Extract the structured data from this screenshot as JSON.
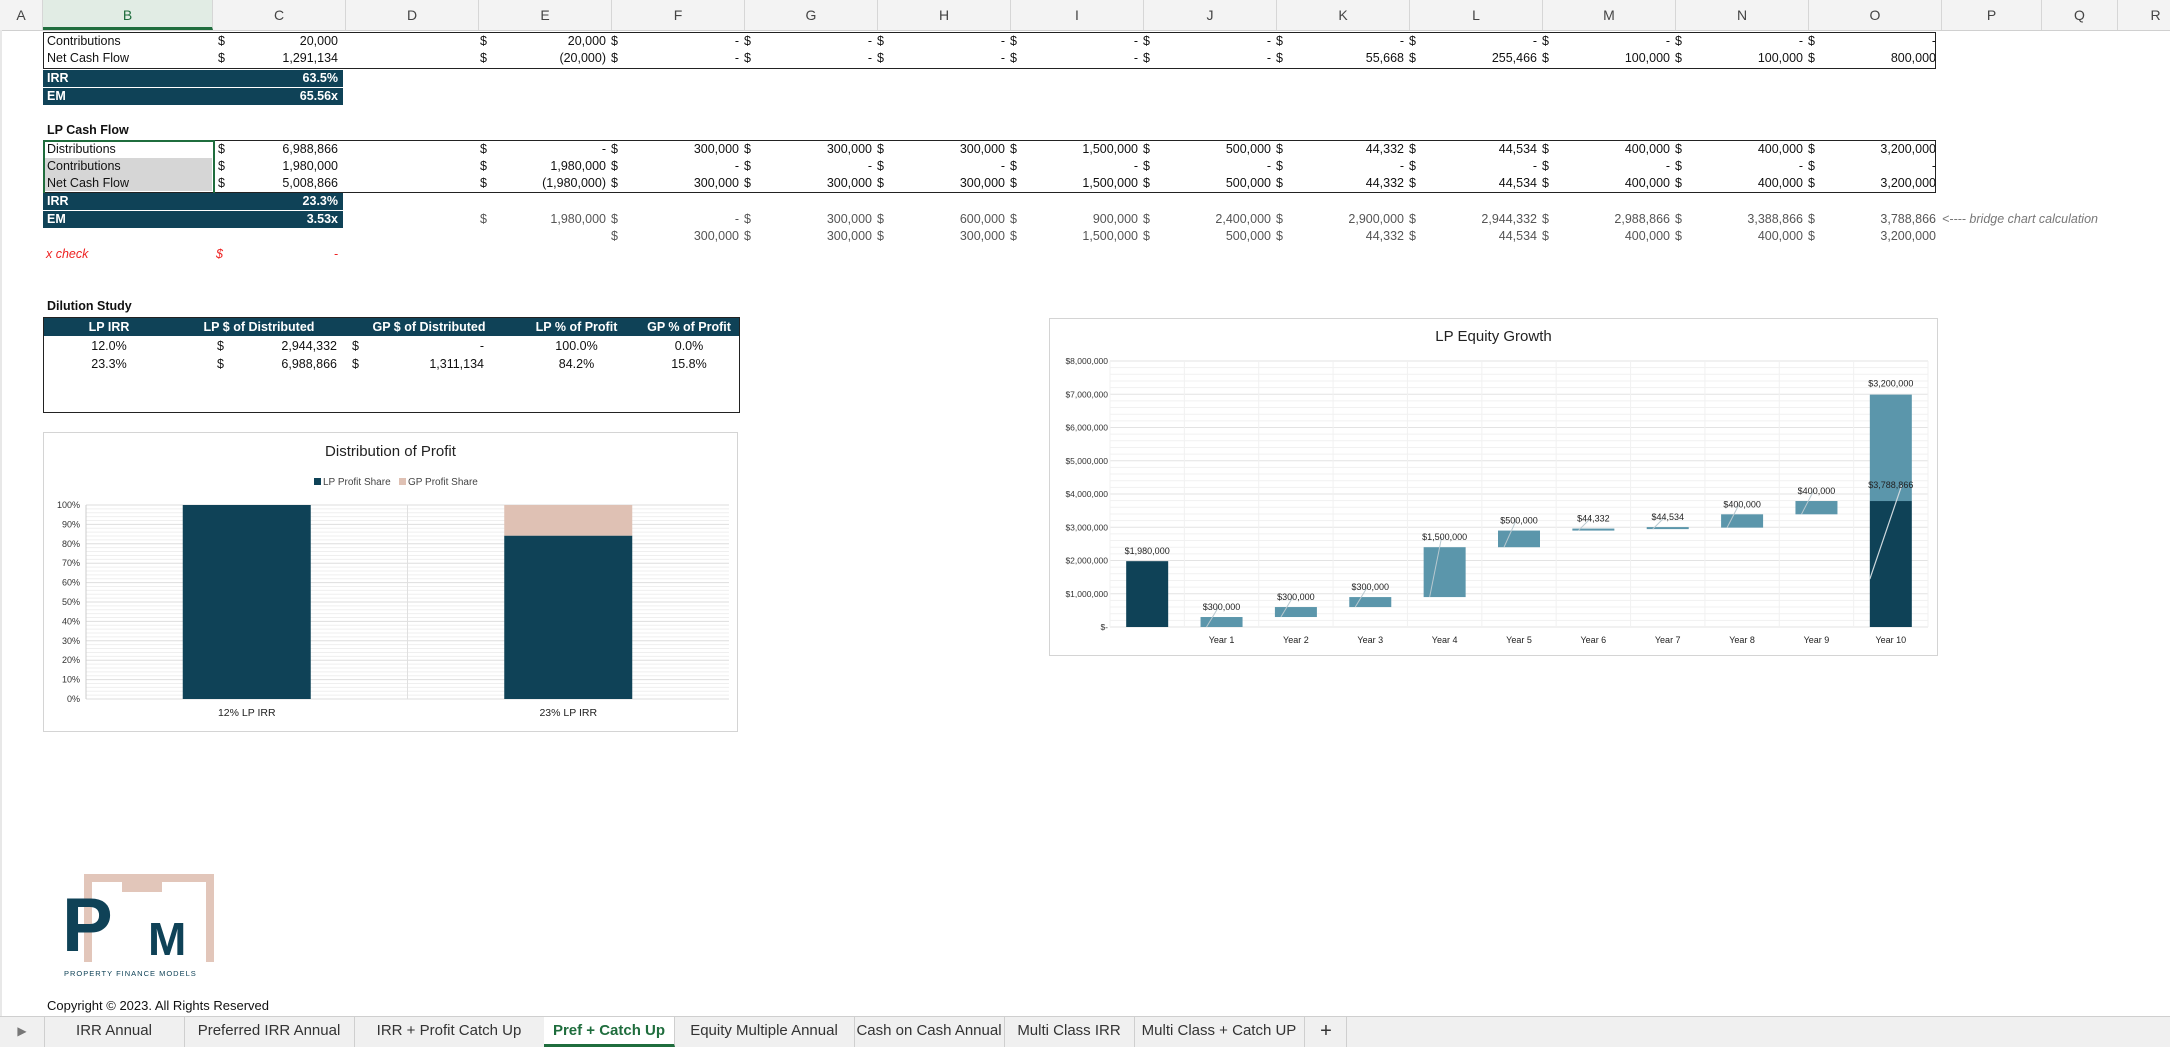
{
  "columns": [
    "A",
    "B",
    "C",
    "D",
    "E",
    "F",
    "G",
    "H",
    "I",
    "J",
    "K",
    "L",
    "M",
    "N",
    "O",
    "P",
    "Q",
    "R"
  ],
  "selected_column": "B",
  "top_table": {
    "rows": [
      {
        "label": "Contributions",
        "c": "20,000",
        "e": "20,000",
        "vals": [
          "-",
          "-",
          "-",
          "-",
          "-",
          "-",
          "-",
          "-",
          "-",
          "-"
        ]
      },
      {
        "label": "Net Cash Flow",
        "c": "1,291,134",
        "e": "(20,000)",
        "vals": [
          "-",
          "-",
          "-",
          "-",
          "-",
          "55,668",
          "255,466",
          "100,000",
          "100,000",
          "800,000"
        ]
      }
    ],
    "irr_label": "IRR",
    "irr_value": "63.5%",
    "em_label": "EM",
    "em_value": "65.56x"
  },
  "lp_cash_flow": {
    "title": "LP Cash Flow",
    "rows": [
      {
        "label": "Distributions",
        "c": "6,988,866",
        "e": "-",
        "vals": [
          "300,000",
          "300,000",
          "300,000",
          "1,500,000",
          "500,000",
          "44,332",
          "44,534",
          "400,000",
          "400,000",
          "3,200,000"
        ]
      },
      {
        "label": "Contributions",
        "c": "1,980,000",
        "e": "1,980,000",
        "vals": [
          "-",
          "-",
          "-",
          "-",
          "-",
          "-",
          "-",
          "-",
          "-",
          "-"
        ]
      },
      {
        "label": "Net Cash Flow",
        "c": "5,008,866",
        "e": "(1,980,000)",
        "vals": [
          "300,000",
          "300,000",
          "300,000",
          "1,500,000",
          "500,000",
          "44,332",
          "44,534",
          "400,000",
          "400,000",
          "3,200,000"
        ]
      }
    ],
    "irr_label": "IRR",
    "irr_value": "23.3%",
    "em_label": "EM",
    "em_value": "3.53x",
    "bridge_row1": {
      "e": "1,980,000",
      "vals": [
        "-",
        "300,000",
        "600,000",
        "900,000",
        "2,400,000",
        "2,900,000",
        "2,944,332",
        "2,988,866",
        "3,388,866",
        "3,788,866"
      ]
    },
    "bridge_row2": {
      "vals": [
        "300,000",
        "300,000",
        "300,000",
        "1,500,000",
        "500,000",
        "44,332",
        "44,534",
        "400,000",
        "400,000",
        "3,200,000"
      ]
    },
    "bridge_note": "<---- bridge chart calculation",
    "check_label": "x check",
    "check_currency": "$",
    "check_value": "-"
  },
  "currency_symbol": "$",
  "dilution": {
    "title": "Dilution Study",
    "headers": [
      "LP IRR",
      "LP $ of Distributed",
      "GP $ of Distributed",
      "LP % of Profit",
      "GP % of Profit"
    ],
    "rows": [
      {
        "irr": "12.0%",
        "lp": "2,944,332",
        "gp": "-",
        "lp_pct": "100.0%",
        "gp_pct": "0.0%"
      },
      {
        "irr": "23.3%",
        "lp": "6,988,866",
        "gp": "1,311,134",
        "lp_pct": "84.2%",
        "gp_pct": "15.8%"
      }
    ]
  },
  "chart_data": [
    {
      "type": "bar",
      "title": "Distribution of Profit",
      "categories": [
        "12%  LP IRR",
        "23%  LP IRR"
      ],
      "series": [
        {
          "name": "LP Profit Share",
          "values": [
            100.0,
            84.2
          ],
          "color": "#0f4257"
        },
        {
          "name": "GP Profit Share",
          "values": [
            0.0,
            15.8
          ],
          "color": "#dfc1b4"
        }
      ],
      "stacked": true,
      "ylim": [
        0,
        100
      ],
      "yticks": [
        "0%",
        "10%",
        "20%",
        "30%",
        "40%",
        "50%",
        "60%",
        "70%",
        "80%",
        "90%",
        "100%"
      ],
      "legend": "top"
    },
    {
      "type": "bar",
      "title": "LP Equity Growth",
      "waterfall": true,
      "categories": [
        "",
        "Year 1",
        "Year 2",
        "Year 3",
        "Year 4",
        "Year 5",
        "Year 6",
        "Year 7",
        "Year 8",
        "Year 9",
        "Year 10"
      ],
      "base": [
        0,
        0,
        300000,
        600000,
        900000,
        2400000,
        2900000,
        2944332,
        2988866,
        3388866,
        3788866
      ],
      "values": [
        1980000,
        300000,
        300000,
        300000,
        1500000,
        500000,
        44332,
        44534,
        400000,
        400000,
        3200000
      ],
      "labels": [
        "$1,980,000",
        "$300,000",
        "$300,000",
        "$300,000",
        "$1,500,000",
        "$500,000",
        "$44,332",
        "$44,534",
        "$400,000",
        "$400,000",
        "$3,200,000"
      ],
      "extra_label": "$3,788,866",
      "ylim": [
        0,
        8000000
      ],
      "yticks": [
        "$-",
        "$1,000,000",
        "$2,000,000",
        "$3,000,000",
        "$4,000,000",
        "$5,000,000",
        "$6,000,000",
        "$7,000,000",
        "$8,000,000"
      ],
      "colors": {
        "total": "#0f4257",
        "delta": "#5b96ab"
      }
    }
  ],
  "logo": {
    "letters": "PTM",
    "tagline": "PROPERTY FINANCE MODELS"
  },
  "copyright": "Copyright © 2023. All Rights Reserved",
  "sheet_tabs": [
    "IRR Annual",
    "Preferred IRR Annual",
    "IRR + Profit Catch Up",
    "Pref + Catch Up",
    "Equity Multiple Annual",
    "Cash on Cash Annual",
    "Multi Class IRR",
    "Multi Class + Catch UP"
  ],
  "active_tab": "Pref + Catch Up",
  "add_tab": "+"
}
